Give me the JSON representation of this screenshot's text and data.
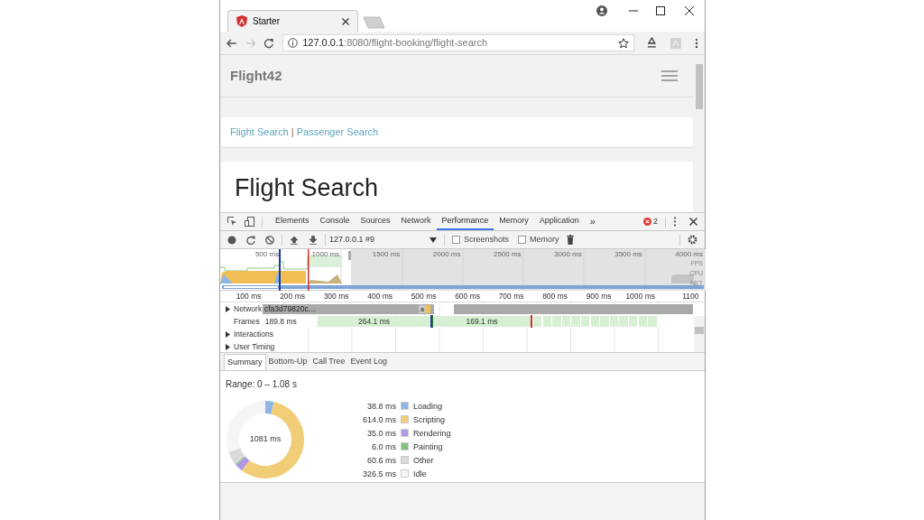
{
  "browser": {
    "tabs": [
      {
        "title": "Starter",
        "selected": true
      }
    ],
    "url_host": "127.0.0.1",
    "url_path": ":8080/flight-booking/flight-search"
  },
  "page": {
    "brand": "Flight42",
    "links": [
      {
        "label": "Flight Search"
      },
      {
        "label": "Passenger Search"
      }
    ],
    "separator": "|",
    "heading": "Flight Search"
  },
  "devtools": {
    "tabs": [
      {
        "label": "Elements",
        "selected": false
      },
      {
        "label": "Console",
        "selected": false
      },
      {
        "label": "Sources",
        "selected": false
      },
      {
        "label": "Network",
        "selected": false
      },
      {
        "label": "Performance",
        "selected": true
      },
      {
        "label": "Memory",
        "selected": false
      },
      {
        "label": "Application",
        "selected": false
      }
    ],
    "more": "»",
    "error_count": "2",
    "profile": "127.0.0.1 #9",
    "checkboxes": [
      {
        "label": "Screenshots",
        "checked": false
      },
      {
        "label": "Memory",
        "checked": false
      }
    ],
    "overview": {
      "ticks": [
        "500 ms",
        "1000 ms",
        "1500 ms",
        "2000 ms",
        "2500 ms",
        "3000 ms",
        "3500 ms",
        "4000 ms"
      ],
      "tracks": [
        "FPS",
        "CPU",
        "NET"
      ]
    },
    "ruler": [
      "100 ms",
      "200 ms",
      "300 ms",
      "400 ms",
      "500 ms",
      "600 ms",
      "700 ms",
      "800 ms",
      "900 ms",
      "1000 ms",
      "1100"
    ],
    "tracks": [
      {
        "kind": "network",
        "label": "Network",
        "expanded": false,
        "request": "cfa3d79820c…",
        "short_request": "a"
      },
      {
        "kind": "frames",
        "label": "Frames",
        "first": "189.8 ms",
        "frames": [
          "264.1 ms",
          "169.1 ms"
        ]
      },
      {
        "kind": "group",
        "label": "Interactions",
        "expanded": false
      },
      {
        "kind": "group",
        "label": "User Timing",
        "expanded": false
      }
    ],
    "summary_tabs": [
      {
        "label": "Summary",
        "selected": true
      },
      {
        "label": "Bottom-Up",
        "selected": false
      },
      {
        "label": "Call Tree",
        "selected": false
      },
      {
        "label": "Event Log",
        "selected": false
      }
    ],
    "range": "Range: 0 – 1.08 s",
    "total": "1081 ms",
    "legend": [
      {
        "value": "38.8 ms",
        "color": "#8fb5e6"
      },
      {
        "value": "614.0 ms",
        "color": "#f2cd78"
      },
      {
        "value": "35.0 ms",
        "color": "#af98e6"
      },
      {
        "value": "6.0 ms",
        "color": "#82c07e"
      },
      {
        "value": "60.6 ms",
        "color": "#dadada"
      },
      {
        "value": "326.5 ms",
        "color": "#f5f5f5"
      }
    ],
    "chart_data": {
      "type": "donut",
      "categories": [
        "Loading",
        "Scripting",
        "Rendering",
        "Painting",
        "Other",
        "Idle"
      ],
      "series": [
        {
          "values": [
            3.6,
            56.8,
            3.2,
            0.6,
            5.6,
            30.2
          ]
        }
      ]
    }
  }
}
